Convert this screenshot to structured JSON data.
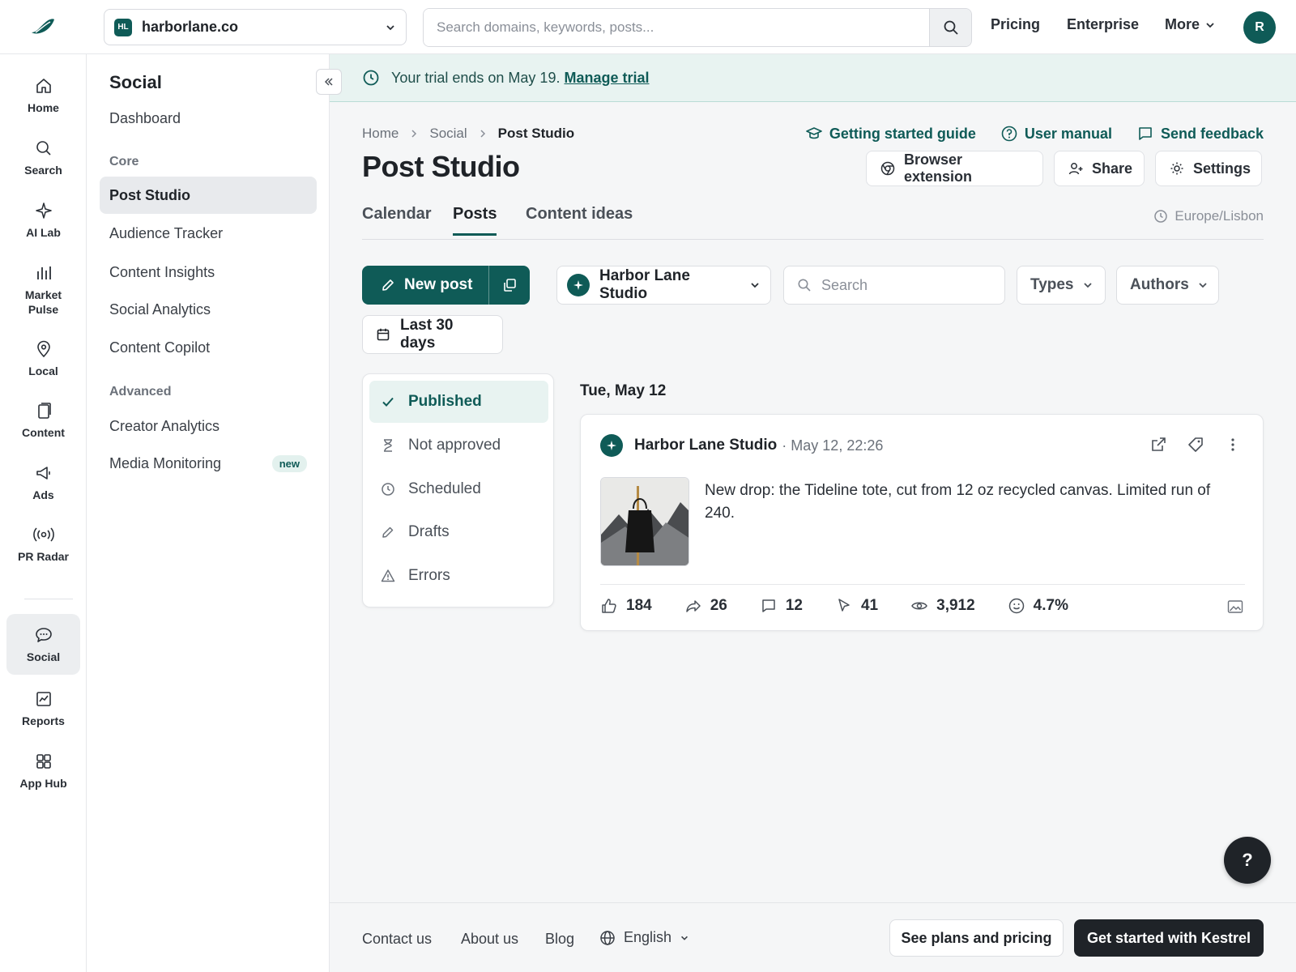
{
  "colors": {
    "brand": "#0f5b57",
    "dark": "#1f2328",
    "trial_bg": "#e8f3f1"
  },
  "topbar": {
    "domain_badge": "HL",
    "domain_name": "harborlane.co",
    "search_placeholder": "Search domains, keywords, posts...",
    "nav": [
      "Pricing",
      "Enterprise",
      "More"
    ],
    "avatar_initial": "R"
  },
  "rail": {
    "items": [
      {
        "label": "Home",
        "icon": "home-icon"
      },
      {
        "label": "Search",
        "icon": "search-icon"
      },
      {
        "label": "AI Lab",
        "icon": "sparkle-icon"
      },
      {
        "label": "Market Pulse",
        "icon": "bars-icon"
      },
      {
        "label": "Local",
        "icon": "pin-icon"
      },
      {
        "label": "Content",
        "icon": "document-icon"
      },
      {
        "label": "Ads",
        "icon": "megaphone-icon"
      },
      {
        "label": "PR Radar",
        "icon": "broadcast-icon"
      },
      {
        "label": "Social",
        "icon": "chat-icon"
      },
      {
        "label": "Reports",
        "icon": "chart-icon"
      },
      {
        "label": "App Hub",
        "icon": "grid-icon"
      }
    ]
  },
  "sidebar": {
    "title": "Social",
    "dashboard": "Dashboard",
    "section_core": "Core",
    "core_items": [
      "Post Studio",
      "Audience Tracker",
      "Content Insights",
      "Social Analytics",
      "Content Copilot"
    ],
    "section_advanced": "Advanced",
    "advanced_items": [
      "Creator Analytics",
      "Media Monitoring"
    ],
    "new_badge": "new"
  },
  "trial": {
    "text": "Your trial ends on May 19.",
    "link": "Manage trial"
  },
  "breadcrumb": [
    "Home",
    "Social",
    "Post Studio"
  ],
  "help_links": [
    "Getting started guide",
    "User manual",
    "Send feedback"
  ],
  "page_title": "Post Studio",
  "header_buttons": [
    "Browser extension",
    "Share",
    "Settings"
  ],
  "tabs": [
    "Calendar",
    "Posts",
    "Content ideas"
  ],
  "timezone": "Europe/Lisbon",
  "toolbar": {
    "new_post": "New post",
    "profile": "Harbor Lane Studio",
    "search_placeholder": "Search",
    "types": "Types",
    "authors": "Authors",
    "date_range": "Last 30 days"
  },
  "statuses": [
    "Published",
    "Not approved",
    "Scheduled",
    "Drafts",
    "Errors"
  ],
  "day_label": "Tue, May 12",
  "post": {
    "author": "Harbor Lane Studio",
    "date": "· May 12, 22:26",
    "text": "New drop: the Tideline tote, cut from 12 oz recycled canvas. Limited run of 240.",
    "stats": {
      "likes": "184",
      "shares": "26",
      "comments": "12",
      "clicks": "41",
      "views": "3,912",
      "engagement": "4.7%"
    }
  },
  "help_fab": "?",
  "footer": {
    "links": [
      "Contact us",
      "About us",
      "Blog"
    ],
    "language": "English",
    "plans_button": "See plans and pricing",
    "cta_button": "Get started with Kestrel"
  }
}
